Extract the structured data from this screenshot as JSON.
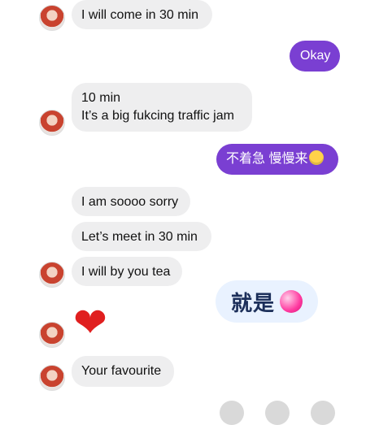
{
  "messages": [
    {
      "side": "in",
      "text": "I will come in 30 min"
    },
    {
      "side": "out",
      "text": "Okay"
    },
    {
      "side": "in",
      "line1": "10 min",
      "line2": "It’s a big fukcing traffic jam"
    },
    {
      "side": "out",
      "text": "不着急 慢慢来"
    },
    {
      "side": "in",
      "text": "I am soooo sorry"
    },
    {
      "side": "in",
      "text": "Let’s meet in 30 min"
    },
    {
      "side": "in",
      "text": "I will by you tea"
    },
    {
      "side": "in",
      "text": "❤"
    },
    {
      "side": "in",
      "text": "Your favourite"
    }
  ],
  "sticker": {
    "text": "就是"
  },
  "icons": {
    "avatar": "profile-avatar",
    "laugh_emoji": "laughing-emoji-icon",
    "heart_sticker": "heart-icon",
    "big_heart": "heart-icon"
  },
  "colors": {
    "outgoing_bubble": "#7a3fd2",
    "incoming_bubble": "#eeeeef"
  }
}
